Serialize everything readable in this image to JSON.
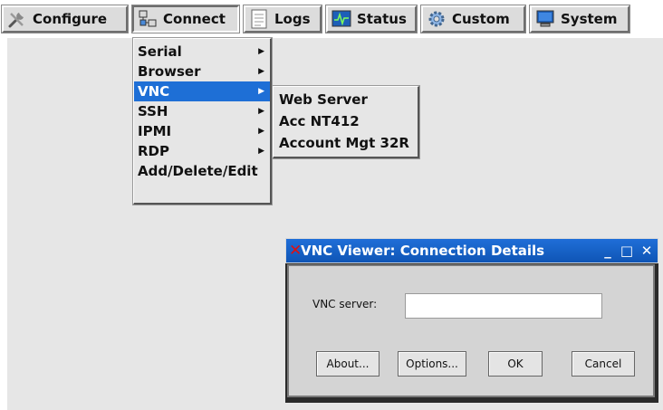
{
  "toolbar": {
    "buttons": [
      {
        "label": "Configure",
        "icon": "tools-icon"
      },
      {
        "label": "Connect",
        "icon": "connect-icon"
      },
      {
        "label": "Logs",
        "icon": "logs-icon"
      },
      {
        "label": "Status",
        "icon": "status-icon"
      },
      {
        "label": "Custom",
        "icon": "gear-icon"
      },
      {
        "label": "System",
        "icon": "monitor-icon"
      }
    ]
  },
  "connect_menu": {
    "items": [
      {
        "label": "Serial",
        "has_submenu": true
      },
      {
        "label": "Browser",
        "has_submenu": true
      },
      {
        "label": "VNC",
        "has_submenu": true,
        "highlighted": true
      },
      {
        "label": "SSH",
        "has_submenu": true
      },
      {
        "label": "IPMI",
        "has_submenu": true
      },
      {
        "label": "RDP",
        "has_submenu": true
      },
      {
        "label": "Add/Delete/Edit",
        "has_submenu": false
      }
    ]
  },
  "vnc_submenu": {
    "items": [
      {
        "label": "Web Server"
      },
      {
        "label": "Acc NT412"
      },
      {
        "label": "Account Mgt 32R"
      }
    ]
  },
  "vnc_dialog": {
    "title": "VNC Viewer: Connection Details",
    "server_label": "VNC server:",
    "server_value": "",
    "buttons": {
      "about": "About...",
      "options": "Options...",
      "ok": "OK",
      "cancel": "Cancel"
    },
    "window_controls": {
      "minimize": "_",
      "maximize": "□",
      "close": "✕"
    }
  },
  "colors": {
    "highlight": "#1e6fd6",
    "titlebar": "#1f6ed8",
    "desktop": "#e6e6e6"
  }
}
